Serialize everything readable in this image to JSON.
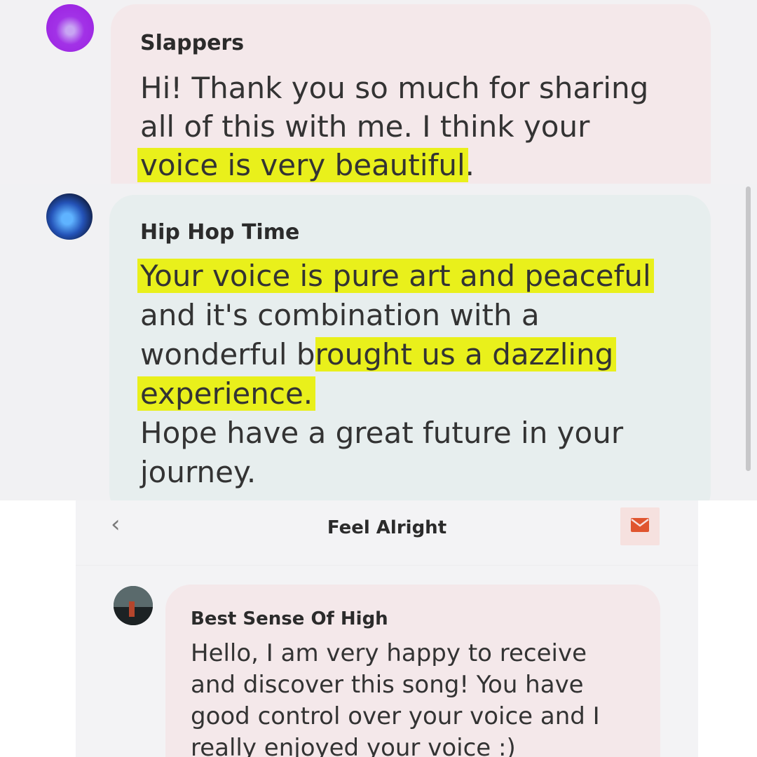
{
  "post1": {
    "author": "Slappers",
    "line1": "Hi! Thank you so much for sharing",
    "line2": "all of this with me. I think your",
    "line3_highlight": "voice is very beautiful",
    "line3_rest": "."
  },
  "post2": {
    "author": "Hip Hop Time",
    "line1_highlight": "Your voice is pure art and peaceful",
    "line2": "and it's combination with a",
    "line3_pre": "wonderful b",
    "line3_highlight": "rought us a dazzling",
    "line4_highlight": "experience.",
    "line5": "Hope have a great future in your",
    "line6": "journey."
  },
  "post3_screen": {
    "header_title": "Feel Alright",
    "back_icon": "chevron-left-icon",
    "mail_icon": "envelope-icon",
    "accent_color": "#e0552f",
    "comment": {
      "author": "Best Sense Of High",
      "line1": "Hello, I am very happy to receive",
      "line2": "and discover this song! You have",
      "line3": "good control over your voice and I",
      "line4": "really enjoyed your voice :)"
    }
  },
  "colors": {
    "highlight": "#e9f01b",
    "bubble_pink": "#f4e8ea",
    "bubble_green": "#e7eeee"
  }
}
